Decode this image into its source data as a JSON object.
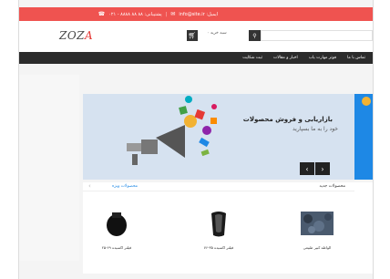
{
  "topbar": {
    "email": "info@site.ir :ایمیل",
    "phone": "۰۲۱ - ۸۸۸۸ ۸۸ ۸۸ :پشتیبانی"
  },
  "header": {
    "logo_main": "ZOZ",
    "logo_accent": "A",
    "cart_text": "سبد خرید ۰",
    "search_placeholder": ""
  },
  "nav": {
    "items": [
      "ثبت شکایت",
      "اخبار و مقالات",
      "فوتر مهارت یاب",
      "تماس با ما"
    ]
  },
  "banner": {
    "title": "بازاریابی و فروش محصولات",
    "subtitle": "خود را به ما بسپارید"
  },
  "products": {
    "tab_new": "محصولات جدید",
    "tab_special": "محصولات ویژه",
    "items": [
      {
        "name": "فیلتر اکسیده ۶۹-۲۵"
      },
      {
        "name": "فیلتر اکسیده ۳۵-۷۶"
      },
      {
        "name": "الواطه کبیر طبیعی"
      }
    ]
  },
  "colors": {
    "topbar": "#ef5350",
    "nav": "#2b2b2b",
    "accent": "#1e88e5"
  }
}
